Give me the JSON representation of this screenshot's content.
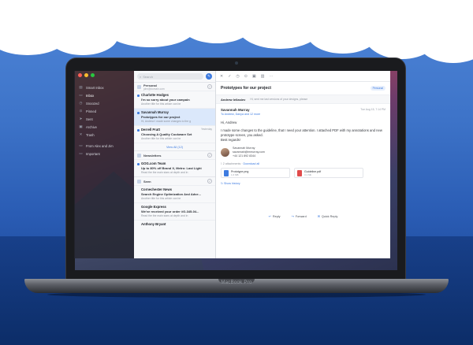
{
  "device": {
    "brand": "MacBook Pro"
  },
  "sidebar": {
    "items": [
      {
        "icon": "inbox-stack-icon",
        "glyph": "▤",
        "label": "Smart Inbox"
      },
      {
        "icon": "inbox-icon",
        "glyph": "▭",
        "label": "Inbox"
      },
      {
        "icon": "clock-icon",
        "glyph": "◷",
        "label": "Snoozed"
      },
      {
        "icon": "pin-icon",
        "glyph": "⊙",
        "label": "Pinned"
      },
      {
        "icon": "send-icon",
        "glyph": "➤",
        "label": "Sent"
      },
      {
        "icon": "archive-icon",
        "glyph": "▣",
        "label": "Archive"
      },
      {
        "icon": "trash-icon",
        "glyph": "✕",
        "label": "Trash"
      },
      {
        "icon": "folder-icon",
        "glyph": "▭",
        "label": "From Alex and Jim"
      },
      {
        "icon": "folder-icon",
        "glyph": "▭",
        "label": "Important"
      }
    ]
  },
  "list": {
    "search_placeholder": "Search",
    "groups": [
      {
        "title": "Personal",
        "subtitle": "john@domain.com",
        "messages": [
          {
            "from": "Charlotte Hodges",
            "date": "",
            "subject": "I'm so sorry about your campain",
            "preview": "Another title for this article can be",
            "unread": true,
            "selected": false
          },
          {
            "from": "Savannah Murray",
            "date": "",
            "subject": "Prototypes for our project",
            "preview": "Hi, Andrew I made some changes to the g",
            "unread": true,
            "selected": true
          },
          {
            "from": "Derrell Pratt",
            "date": "Yesterday",
            "subject": "Choosing A Quality Cookware Set",
            "preview": "Another title for this article can be",
            "unread": true,
            "selected": false
          }
        ],
        "view_all": "View All (12)"
      },
      {
        "title": "Newsletters",
        "subtitle": "",
        "messages": [
          {
            "from": "GOG.com Team",
            "date": "",
            "subject": "Up to 80% off Brand X, Metro: Last Light",
            "preview": "Read the the main stars at depth and in",
            "unread": true,
            "selected": false
          }
        ],
        "view_all": ""
      },
      {
        "title": "Seen",
        "subtitle": "",
        "messages": [
          {
            "from": "Cornechester News",
            "date": "",
            "subject": "Search Engine Optimization And Adve...",
            "preview": "Another title for this article can be",
            "unread": false,
            "selected": false
          },
          {
            "from": "Google Express",
            "date": "",
            "subject": "We've received your order #G-345-04...",
            "preview": "Read the the main stars at depth and in",
            "unread": false,
            "selected": false
          },
          {
            "from": "Anthony Bryant",
            "date": "",
            "subject": "",
            "preview": "",
            "unread": false,
            "selected": false
          }
        ],
        "view_all": ""
      }
    ]
  },
  "reader": {
    "title": "Prototypes for our project",
    "label": "Personal",
    "thread_preview": {
      "from": "Andrew Iellasiev",
      "text": "Hi, sent me last versions of your designs, please"
    },
    "email": {
      "from": "Savannah Murray",
      "to": "To Andrew, Danya and 12 more",
      "date": "Tue Aug 15, 7:14 PM",
      "greeting": "Hi, Andrew",
      "body": "I made some changes to the guideline, that I need your attention. I attached PDF with my annotations and new prototype screen, you asked.",
      "signoff": "Best regards!",
      "signature": {
        "name": "Savannah Murray",
        "email": "savannah@mmurray.com",
        "phone": "+44 121 892 8344"
      }
    },
    "attachments_count": "2 attachments",
    "download_all": "Download all",
    "attachments": [
      {
        "name": "Prototype.png",
        "size": "1.6 MB",
        "color": "#3d7be0"
      },
      {
        "name": "Guideline.pdf",
        "size": "3.1 Mb",
        "color": "#e14b4b"
      }
    ],
    "show_history": "Show history",
    "actions": [
      {
        "icon": "reply-icon",
        "glyph": "↩",
        "label": "Reply"
      },
      {
        "icon": "forward-icon",
        "glyph": "↪",
        "label": "Forward"
      },
      {
        "icon": "quick-reply-icon",
        "glyph": "✉",
        "label": "Quick Reply"
      }
    ]
  },
  "colors": {
    "accent": "#3d7be0",
    "sky": "#4f86d8",
    "sea": "#0c2d68"
  }
}
